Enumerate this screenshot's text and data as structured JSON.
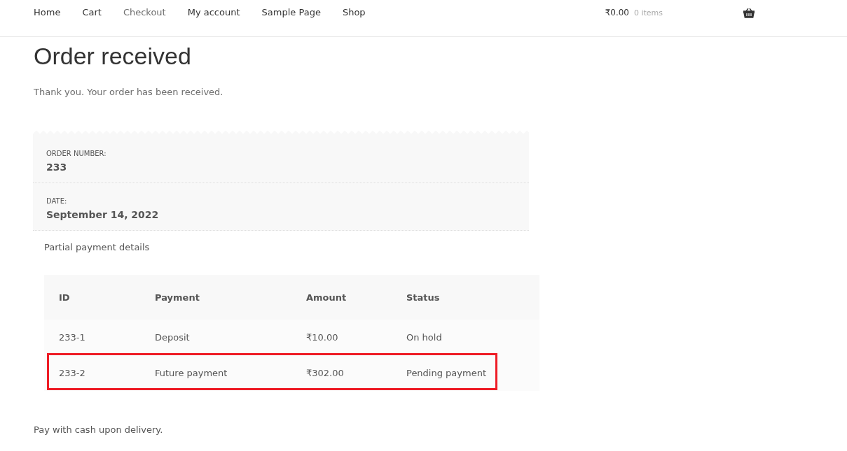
{
  "nav": {
    "items": [
      {
        "label": "Home",
        "selected": false
      },
      {
        "label": "Cart",
        "selected": false
      },
      {
        "label": "Checkout",
        "selected": true
      },
      {
        "label": "My account",
        "selected": false
      },
      {
        "label": "Sample Page",
        "selected": false
      },
      {
        "label": "Shop",
        "selected": false
      }
    ],
    "cart": {
      "amount": "₹0.00",
      "count": "0 items"
    }
  },
  "page_title": "Order received",
  "notice": "Thank you. Your order has been received.",
  "order_overview": [
    {
      "label": "ORDER NUMBER:",
      "value": "233"
    },
    {
      "label": "DATE:",
      "value": "September 14, 2022"
    }
  ],
  "partial_payments": {
    "title": "Partial payment details",
    "table": {
      "columns": [
        "ID",
        "Payment",
        "Amount",
        "Status"
      ],
      "rows": [
        {
          "cells": [
            "233-1",
            "Deposit",
            "₹10.00",
            "On hold"
          ],
          "highlighted": false
        },
        {
          "cells": [
            "233-2",
            "Future payment",
            "₹302.00",
            "Pending payment"
          ],
          "highlighted": true
        }
      ]
    }
  },
  "payment_note": "Pay with cash upon delivery."
}
